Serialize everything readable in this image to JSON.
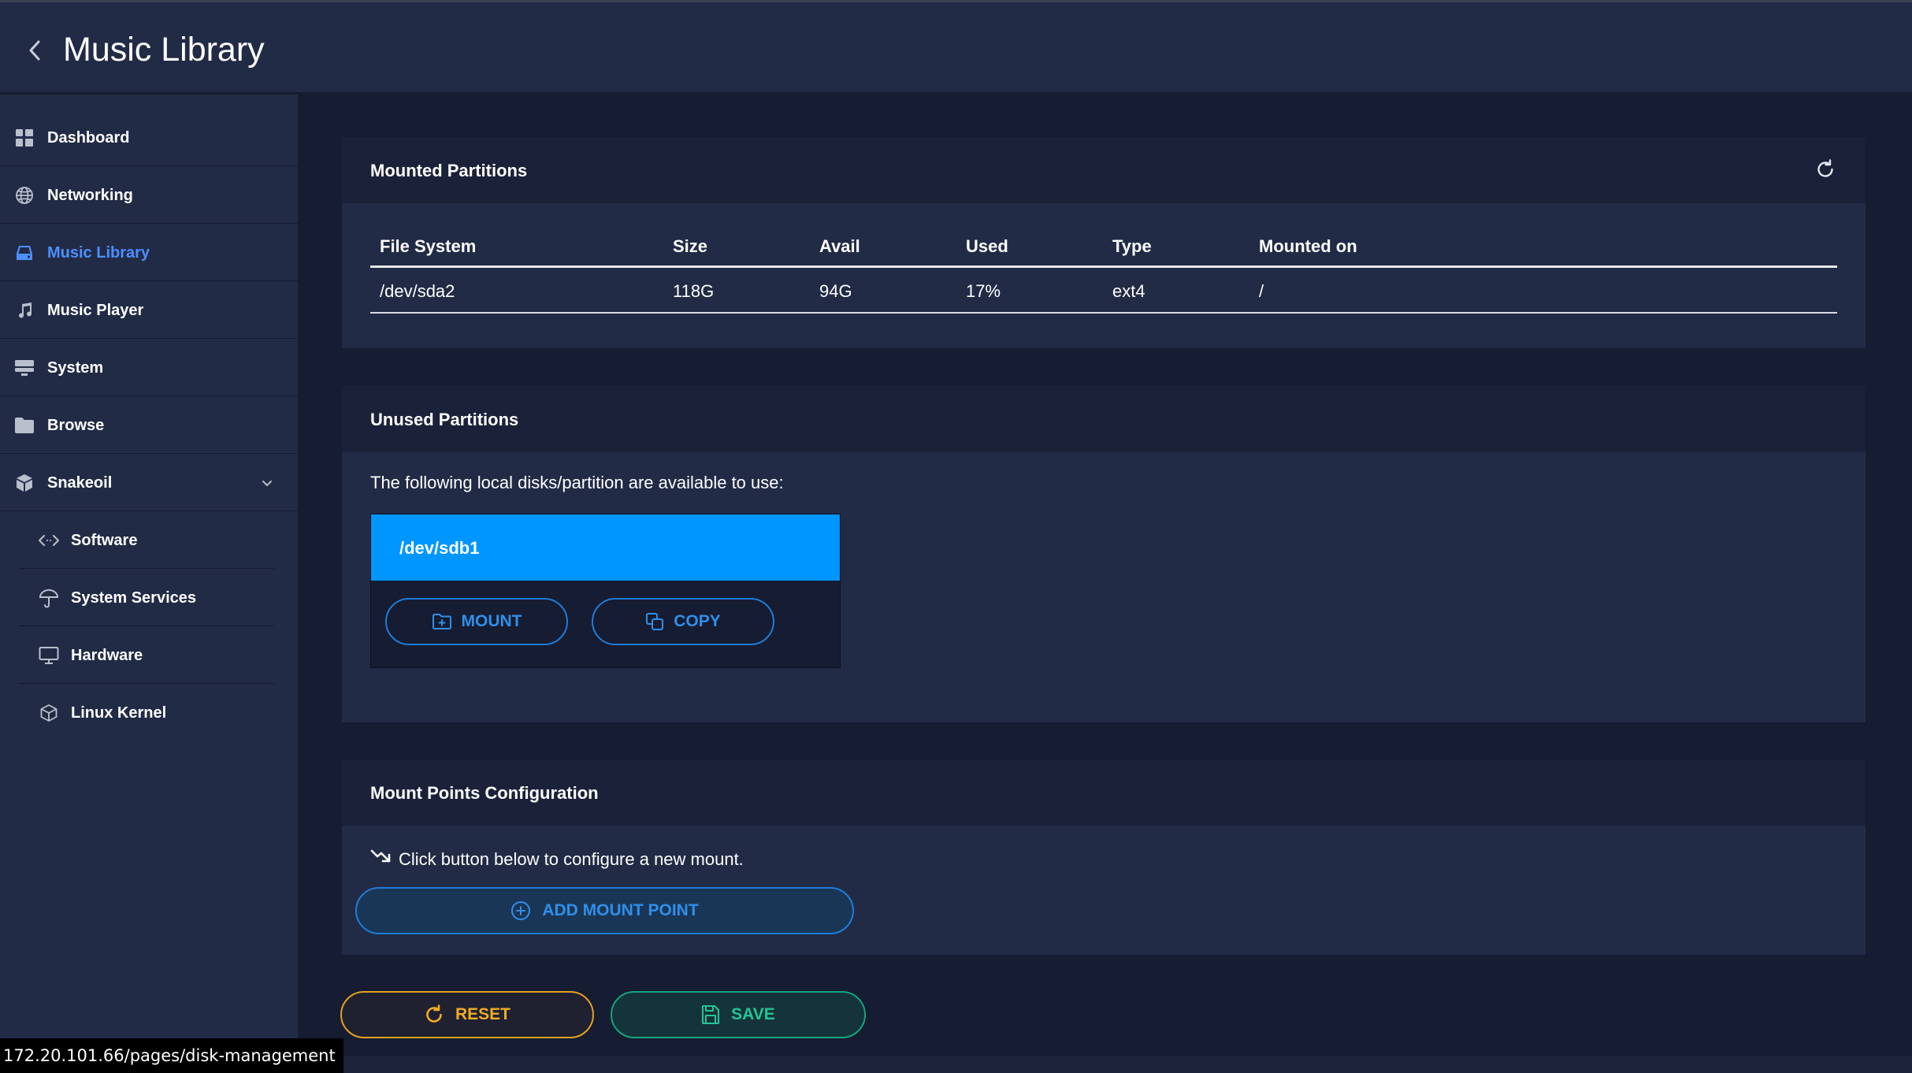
{
  "colors": {
    "page_bg": "#161c31",
    "panel_bg": "#212b46",
    "accent_blue": "#0096ff",
    "active_nav": "#4d8fff",
    "reset": "#f1ab24",
    "save": "#25c596"
  },
  "header": {
    "back_icon": "chevron-left-icon",
    "title": "Music Library"
  },
  "sidebar": {
    "items": [
      {
        "label": "Dashboard",
        "icon": "grid-icon"
      },
      {
        "label": "Networking",
        "icon": "globe-icon"
      },
      {
        "label": "Music Library",
        "icon": "drive-icon",
        "active": true
      },
      {
        "label": "Music Player",
        "icon": "music-note-icon"
      },
      {
        "label": "System",
        "icon": "monitor-stack-icon"
      },
      {
        "label": "Browse",
        "icon": "folder-icon"
      },
      {
        "label": "Snakeoil",
        "icon": "cube-icon",
        "expanded": true
      }
    ],
    "subitems": [
      {
        "label": "Software",
        "icon": "code-icon"
      },
      {
        "label": "System Services",
        "icon": "umbrella-icon"
      },
      {
        "label": "Hardware",
        "icon": "monitor-icon"
      },
      {
        "label": "Linux Kernel",
        "icon": "box-icon"
      }
    ]
  },
  "mounted": {
    "title": "Mounted Partitions",
    "refresh_icon": "refresh-icon",
    "columns": [
      "File System",
      "Size",
      "Avail",
      "Used",
      "Type",
      "Mounted on"
    ],
    "rows": [
      [
        "/dev/sda2",
        "118G",
        "94G",
        "17%",
        "ext4",
        "/"
      ]
    ]
  },
  "unused": {
    "title": "Unused Partitions",
    "description": "The following local disks/partition are available to use:",
    "partitions": [
      {
        "name": "/dev/sdb1",
        "mount_label": "MOUNT",
        "copy_label": "COPY"
      }
    ]
  },
  "mount_points": {
    "title": "Mount Points Configuration",
    "hint": "Click button below to configure a new mount.",
    "add_label": "ADD MOUNT POINT"
  },
  "actions": {
    "reset_label": "RESET",
    "save_label": "SAVE"
  },
  "status_url": "172.20.101.66/pages/disk-management"
}
